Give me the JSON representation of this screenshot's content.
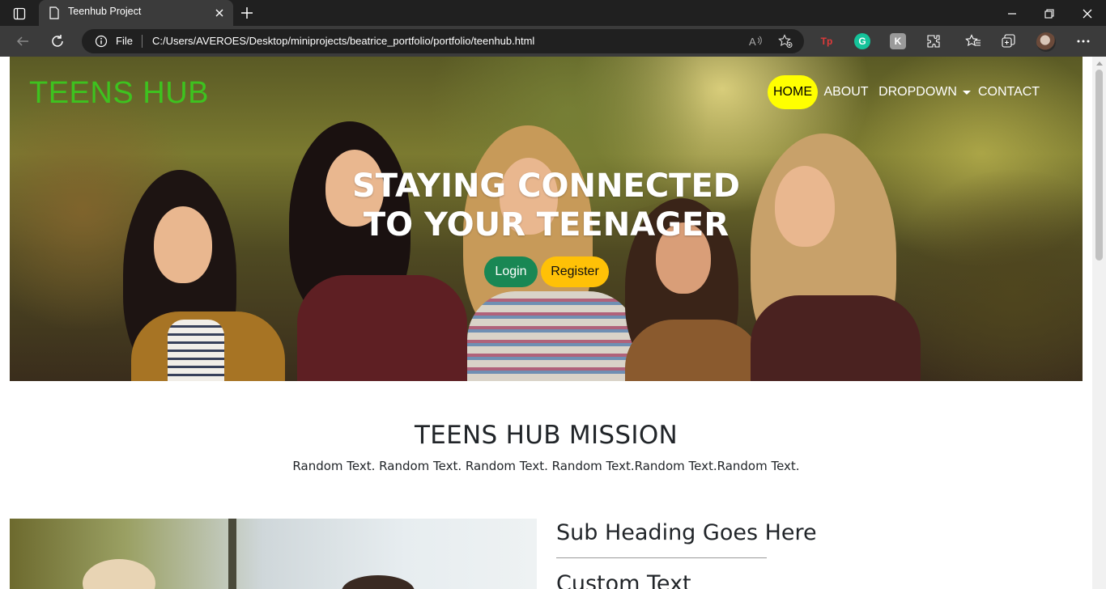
{
  "browser": {
    "tab_title": "Teenhub Project",
    "scheme_label": "File",
    "url": "C:/Users/AVEROES/Desktop/miniprojects/beatrice_portfolio/portfolio/teenhub.html"
  },
  "extensions": [
    {
      "name": "tp-extension",
      "text": "Tp",
      "color": "#e03a3a"
    },
    {
      "name": "grammarly-extension",
      "text": "G",
      "color": "#15c39a"
    },
    {
      "name": "k-extension",
      "text": "K",
      "color": "#9a9a9a"
    }
  ],
  "site": {
    "brand": "TEENS HUB",
    "nav": {
      "home": "HOME",
      "about": "ABOUT",
      "dropdown": "DROPDOWN",
      "contact": "CONTACT"
    },
    "hero": {
      "line1": "STAYING CONNECTED",
      "line2": "TO YOUR TEENAGER",
      "login": "Login",
      "register": "Register"
    },
    "mission": {
      "title": "TEENS HUB MISSION",
      "text": "Random Text. Random Text. Random Text. Random Text.Random Text.Random Text."
    },
    "feature": {
      "sub_heading": "Sub Heading Goes Here",
      "custom_text": "Custom Text"
    }
  },
  "colors": {
    "brand": "#3ec21f",
    "home_bg": "#ffff00",
    "login_bg": "#198754",
    "register_bg": "#ffc107"
  }
}
